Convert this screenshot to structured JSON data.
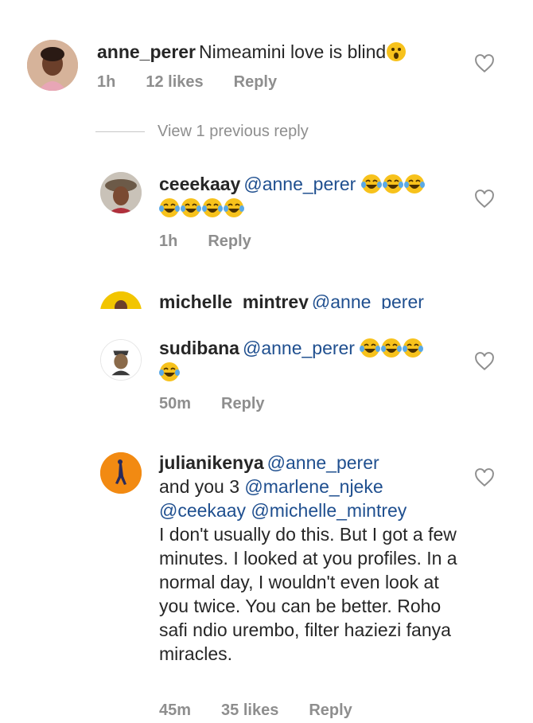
{
  "comments": [
    {
      "username": "anne_perer",
      "text": "Nimeamini love is blind",
      "emoji": "astonished-face",
      "time": "1h",
      "likes": "12 likes",
      "reply": "Reply"
    },
    {
      "username": "ceeekaay",
      "mention": "@anne_perer",
      "emoji_count": 7,
      "emoji": "tears-of-joy-face",
      "time": "1h",
      "reply": "Reply"
    },
    {
      "username": "michelle_mintrey",
      "mention": "@anne_perer"
    },
    {
      "username": "sudibana",
      "mention": "@anne_perer",
      "emoji_count": 4,
      "emoji": "tears-of-joy-face",
      "time": "50m",
      "reply": "Reply"
    },
    {
      "username": "julianikenya",
      "mention": "@anne_perer",
      "line2_prefix": "and you 3 ",
      "mention2": "@marlene_njeke",
      "mention3": "@ceekaay",
      "mention4": "@michelle_mintrey",
      "text": "I don't usually do this. But I got a few minutes. I looked at you profiles. In a normal day, I wouldn't even look at you twice. You can be better. Roho safi ndio urembo, filter haziezi fanya miracles.",
      "time": "45m",
      "likes": "35 likes",
      "reply": "Reply"
    }
  ],
  "view_previous": "View 1 previous reply",
  "icons": {
    "like": "heart-outline-icon"
  },
  "colors": {
    "mention": "#1f4f8f",
    "meta": "#8e8e8e",
    "emoji_yellow": "#f7c21c"
  }
}
